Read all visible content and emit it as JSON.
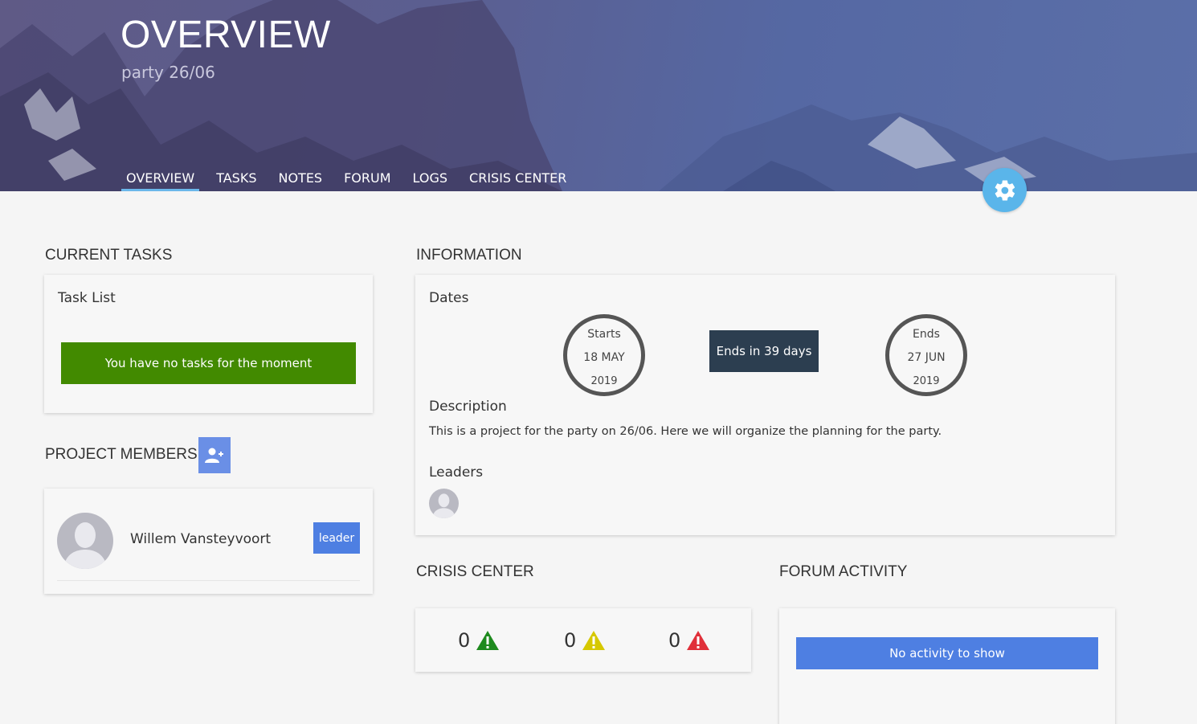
{
  "header": {
    "title": "OVERVIEW",
    "subtitle": "party 26/06",
    "tabs": [
      {
        "label": "OVERVIEW",
        "active": true
      },
      {
        "label": "TASKS"
      },
      {
        "label": "NOTES"
      },
      {
        "label": "FORUM"
      },
      {
        "label": "LOGS"
      },
      {
        "label": "CRISIS CENTER"
      }
    ],
    "settings_icon": "gear-icon"
  },
  "current_tasks": {
    "heading": "CURRENT TASKS",
    "card_title": "Task List",
    "empty_message": "You have no tasks for the moment"
  },
  "project_members": {
    "heading": "PROJECT MEMBERS",
    "add_icon": "add-user-icon",
    "members": [
      {
        "name": "Willem Vansteyvoort",
        "role": "leader"
      }
    ]
  },
  "information": {
    "heading": "INFORMATION",
    "dates_title": "Dates",
    "start": {
      "label": "Starts",
      "day_month": "18 MAY",
      "year": "2019"
    },
    "countdown": "Ends in 39 days",
    "end": {
      "label": "Ends",
      "day_month": "27 JUN",
      "year": "2019"
    },
    "description_title": "Description",
    "description": "This is a project for the party on 26/06. Here we will organize the planning for the party.",
    "leaders_title": "Leaders"
  },
  "crisis_center": {
    "heading": "CRISIS CENTER",
    "items": [
      {
        "count": "0",
        "level": "low",
        "color": "#1e8a1e"
      },
      {
        "count": "0",
        "level": "medium",
        "color": "#d6c800"
      },
      {
        "count": "0",
        "level": "high",
        "color": "#e0303a"
      }
    ]
  },
  "forum_activity": {
    "heading": "FORUM ACTIVITY",
    "empty_message": "No activity to show"
  },
  "colors": {
    "accent_blue": "#4e7fe2",
    "green": "#428a00",
    "dark": "#2c3e50",
    "settings_blue": "#5ab5ea"
  }
}
